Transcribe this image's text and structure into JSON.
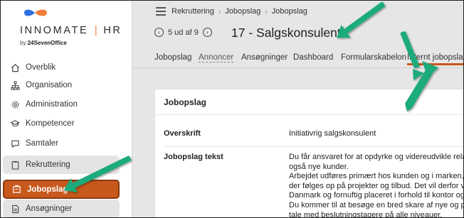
{
  "logo": {
    "brand": "INNOMATE",
    "product": "HR",
    "by_prefix": "by",
    "by_company": "24SevenOffice",
    "colors": {
      "blue": "#2f6fe0",
      "orange": "#f07d3a"
    }
  },
  "sidebar": {
    "items": [
      {
        "label": "Overblik",
        "icon": "house-icon"
      },
      {
        "label": "Organisation",
        "icon": "org-chart-icon"
      },
      {
        "label": "Administration",
        "icon": "gear-icon"
      },
      {
        "label": "Kompetencer",
        "icon": "graduation-cap-icon"
      },
      {
        "label": "Samtaler",
        "icon": "chat-icon"
      },
      {
        "label": "Rekruttering",
        "icon": "clipboard-icon"
      },
      {
        "label": "Jobopslag",
        "icon": "job-post-icon"
      },
      {
        "label": "Ansøgninger",
        "icon": "document-icon"
      }
    ],
    "active_color": "#c8591c"
  },
  "header": {
    "breadcrumb": [
      "Rekruttering",
      "Jobopslag",
      "Jobopslag"
    ],
    "pager": {
      "text": "5 ud af 9"
    },
    "title": "17 - Salgskonsulent"
  },
  "tabs": [
    {
      "label": "Jobopslag"
    },
    {
      "label": "Annoncer"
    },
    {
      "label": "Ansøgninger"
    },
    {
      "label": "Dashboard"
    },
    {
      "label": "Formularskabelon"
    },
    {
      "label": "Internt jobopslag"
    }
  ],
  "card": {
    "heading": "Jobopslag",
    "fields": {
      "overskrift_label": "Overskrift",
      "overskrift_value": "Initiativrig salgskonsulent",
      "tekst_label": "Jobopslag tekst",
      "tekst_lines": [
        "Du får ansvaret for at opdyrke og videreudvikle relatione",
        "også nye kunder.",
        "Arbejdet udføres primært hos kunden og i marken, men",
        "der følges op på projekter og tilbud. Det vil derfor være",
        "Danmark og fornuftig placeret i forhold til kontor og fabr",
        "Du kommer til at besøge en bred skare af nye og potent",
        "tale med beslutningstagere på alle niveauer."
      ]
    }
  },
  "annotation_color": "#1aab7a"
}
